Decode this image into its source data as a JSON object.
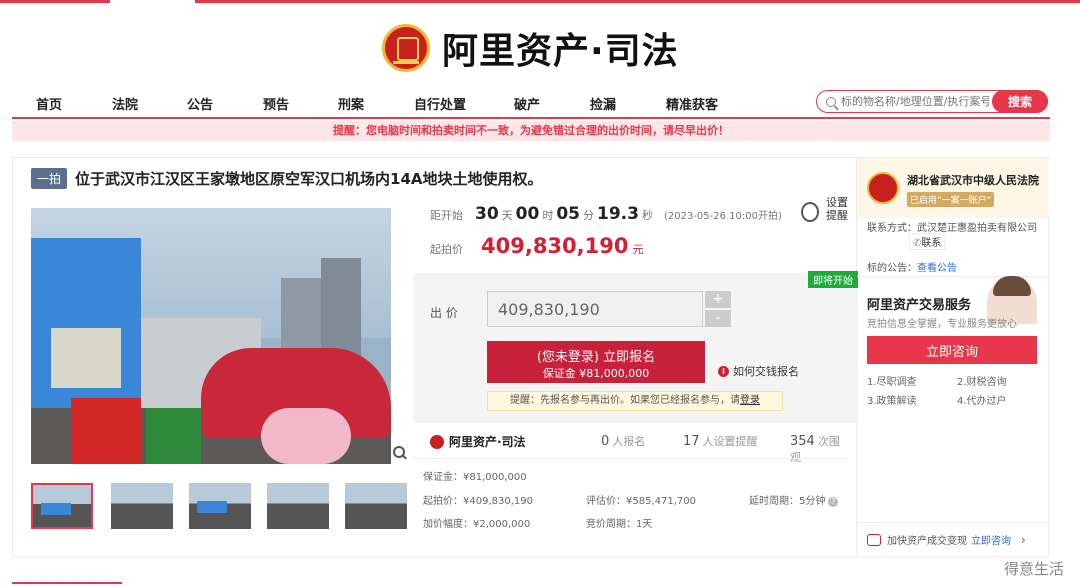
{
  "header": {
    "logo_text": "阿里资产·司法"
  },
  "nav": {
    "items": [
      "首页",
      "法院",
      "公告",
      "预告",
      "刑案",
      "自行处置",
      "破产",
      "捡漏",
      "精准获客"
    ]
  },
  "search": {
    "placeholder": "标的物名称/地理位置/执行案号",
    "button_label": "搜索"
  },
  "notice": "提醒：您电脑时间和拍卖时间不一致，为避免错过合理的出价时间，请尽早出价！",
  "listing": {
    "tag": "一拍",
    "title": "位于武汉市江汉区王家墩地区原空军汉口机场内14A地块土地使用权。"
  },
  "countdown": {
    "label": "距开始",
    "days": "30",
    "days_unit": "天",
    "hours": "00",
    "hours_unit": "时",
    "minutes": "05",
    "minutes_unit": "分",
    "seconds": "19.3",
    "seconds_unit": "秒",
    "start_time": "(2023-05-26 10:00开拍)",
    "reminder_l1": "设置",
    "reminder_l2": "提醒"
  },
  "start_price": {
    "label": "起拍价",
    "value": "409,830,190",
    "unit": "元"
  },
  "bid": {
    "badge": "即将开始",
    "label": "出 价",
    "value": "409,830,190",
    "plus": "+",
    "minus": "-",
    "signup_l1": "(您未登录) 立即报名",
    "signup_l2": "保证金 ¥81,000,000",
    "howpay": "如何交钱报名",
    "reminder_text": "提醒：先报名参与再出价。如果您已经报名参与，请",
    "login_link": "登录"
  },
  "stats": {
    "brand": "阿里资产·司法",
    "signups": "0",
    "signups_label": "人报名",
    "reminders": "17",
    "reminders_label": "人设置提醒",
    "views": "354",
    "views_label": "次围观"
  },
  "details": {
    "deposit": "保证金：¥81,000,000",
    "start_price": "起拍价：¥409,830,190",
    "appraisal": "评估价：¥585,471,700",
    "extension": "延时周期：5分钟",
    "increment": "加价幅度：¥2,000,000",
    "auction_period": "竞价周期：1天",
    "help": "?"
  },
  "sidebar": {
    "court_name": "湖北省武汉市中级人民法院",
    "court_badge": "已启用“一案一账户”",
    "contact": "联系方式：武汉楚正惠盈拍卖有限公司",
    "contact_button": "联系",
    "notice_label": "标的公告：",
    "notice_link": "查看公告",
    "service_title": "阿里资产交易服务",
    "service_sub": "竞拍信息全掌握，专业服务更放心",
    "consult_button": "立即咨询",
    "services": [
      "1.尽职调查",
      "2.财税咨询",
      "3.政策解读",
      "4.代办过户"
    ],
    "accelerate_text": "加快资产成交变现",
    "accelerate_link": "立即咨询",
    "accelerate_chevron": "›"
  },
  "watermark": "得意生活"
}
